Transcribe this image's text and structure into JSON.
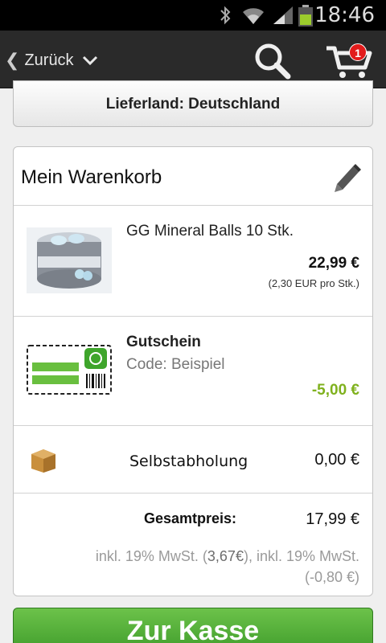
{
  "statusbar": {
    "time": "18:46"
  },
  "actionbar": {
    "back_label": "Zurück",
    "cart_count": "1"
  },
  "country_label": "Lieferland: Deutschland",
  "cart": {
    "title": "Mein Warenkorb",
    "item": {
      "name": "GG Mineral Balls 10 Stk.",
      "price": "22,99 €",
      "unit_price": "(2,30 EUR pro Stk.)",
      "image_label": "GG Mineral Balls"
    },
    "voucher": {
      "title": "Gutschein",
      "code": "Code: Beispiel",
      "amount": "-5,00 €"
    },
    "shipping": {
      "label": "Selbstabholung",
      "price": "0,00 €"
    },
    "total": {
      "label": "Gesamtpreis:",
      "value": "17,99 €",
      "tax_prefix": "inkl. 19% MwSt. (",
      "tax_value": "3,67€",
      "tax_middle": "), inkl. 19% MwSt.",
      "tax_line2": "(-0,80 €)"
    }
  },
  "checkout_label": "Zur Kasse",
  "colors": {
    "accent_green": "#7fb11d",
    "button_green": "#4aa832",
    "badge_red": "#e21b1b"
  },
  "icons": [
    "bluetooth-icon",
    "wifi-icon",
    "signal-icon",
    "battery-icon",
    "back-icon",
    "chevron-down-icon",
    "search-icon",
    "cart-icon",
    "pencil-icon",
    "voucher-icon",
    "package-icon"
  ]
}
